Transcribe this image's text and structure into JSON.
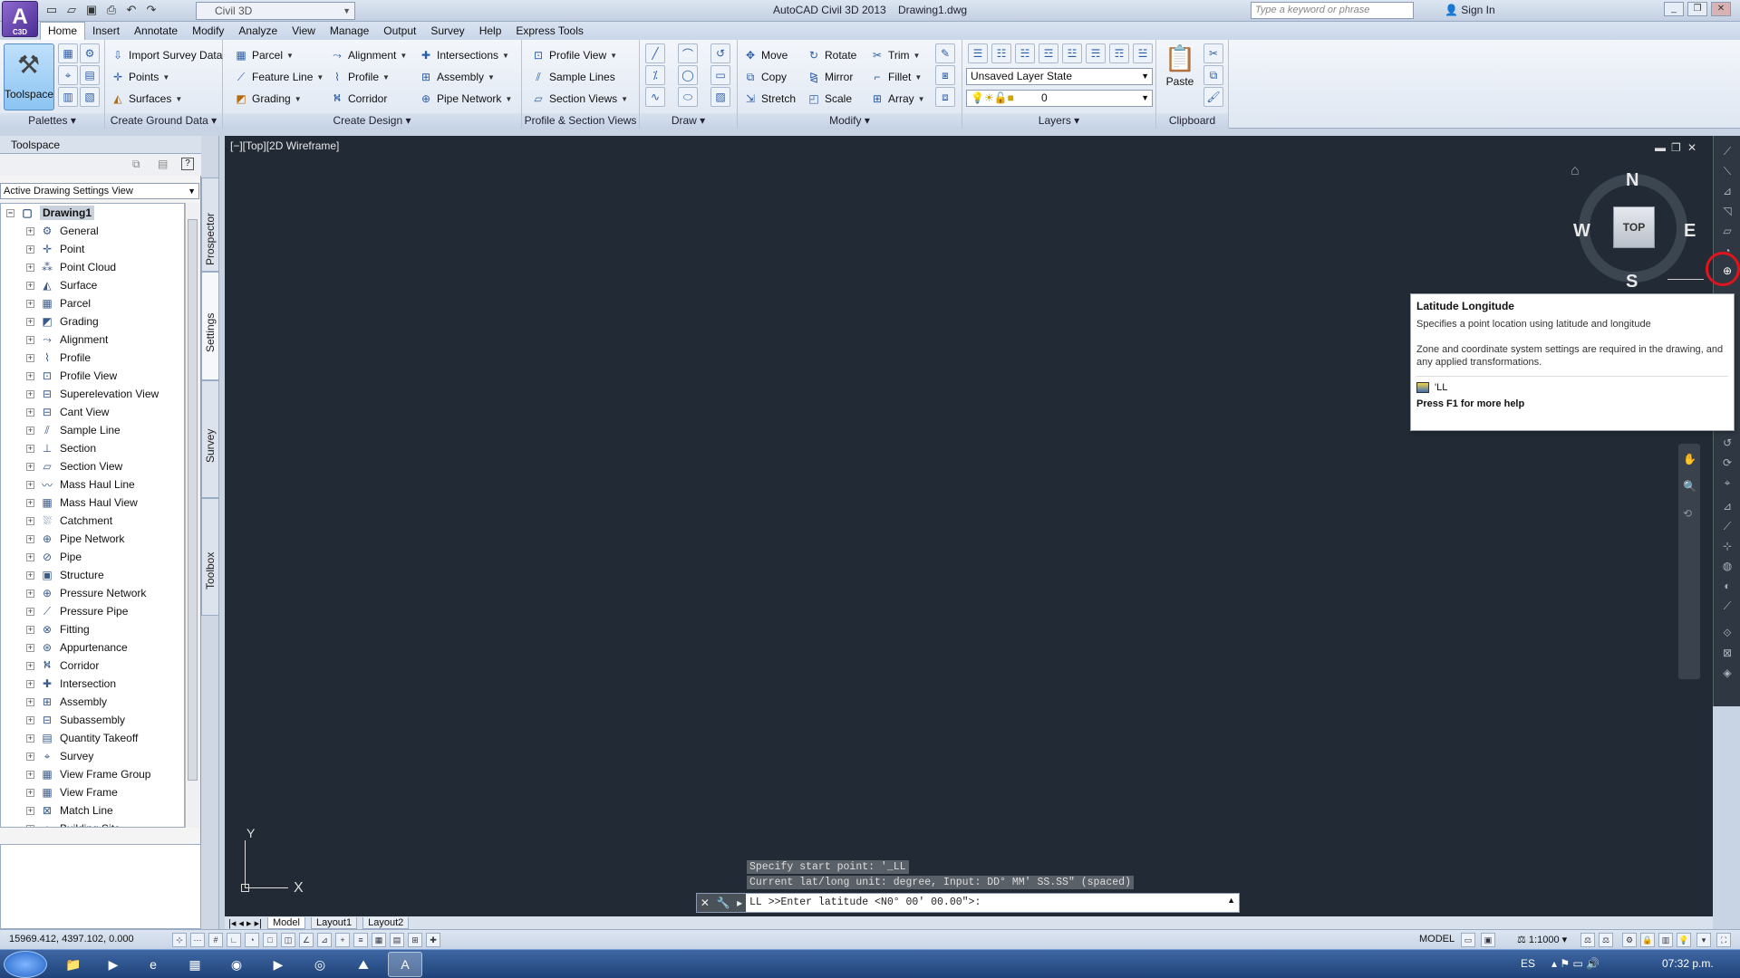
{
  "app": {
    "title": "AutoCAD Civil 3D 2013",
    "document": "Drawing1.dwg",
    "logo_text": "C3D",
    "workspace": "Civil 3D",
    "search_placeholder": "Type a keyword or phrase",
    "sign_in": "Sign In"
  },
  "menu_tabs": [
    "Home",
    "Insert",
    "Annotate",
    "Modify",
    "Analyze",
    "View",
    "Manage",
    "Output",
    "Survey",
    "Help",
    "Express Tools"
  ],
  "ribbon": {
    "palettes": {
      "big_label": "Toolspace",
      "title": "Palettes"
    },
    "ground": {
      "title": "Create Ground Data",
      "items": [
        "Import Survey Data",
        "Points",
        "Surfaces"
      ]
    },
    "design": {
      "title": "Create Design",
      "col1": [
        "Parcel",
        "Feature Line",
        "Grading"
      ],
      "col2": [
        "Alignment",
        "Profile",
        "Corridor"
      ],
      "col3": [
        "Intersections",
        "Assembly",
        "Pipe Network"
      ]
    },
    "profile": {
      "title": "Profile & Section Views",
      "items": [
        "Profile View",
        "Sample Lines",
        "Section Views"
      ]
    },
    "draw": {
      "title": "Draw"
    },
    "modify": {
      "title": "Modify",
      "col1": [
        "Move",
        "Copy",
        "Stretch"
      ],
      "col2": [
        "Rotate",
        "Mirror",
        "Scale"
      ],
      "col3": [
        "Trim",
        "Fillet",
        "Array"
      ]
    },
    "layers": {
      "title": "Layers",
      "layer_state": "Unsaved Layer State",
      "current_layer": "0"
    },
    "clipboard": {
      "title": "Clipboard",
      "paste": "Paste"
    }
  },
  "toolspace": {
    "title": "Toolspace",
    "view": "Active Drawing Settings View",
    "vertical_tabs": [
      "Prospector",
      "Settings",
      "Survey",
      "Toolbox"
    ],
    "root": "Drawing1",
    "items": [
      "General",
      "Point",
      "Point Cloud",
      "Surface",
      "Parcel",
      "Grading",
      "Alignment",
      "Profile",
      "Profile View",
      "Superelevation View",
      "Cant View",
      "Sample Line",
      "Section",
      "Section View",
      "Mass Haul Line",
      "Mass Haul View",
      "Catchment",
      "Pipe Network",
      "Pipe",
      "Structure",
      "Pressure Network",
      "Pressure Pipe",
      "Fitting",
      "Appurtenance",
      "Corridor",
      "Intersection",
      "Assembly",
      "Subassembly",
      "Quantity Takeoff",
      "Survey",
      "View Frame Group",
      "View Frame",
      "Match Line",
      "Building Site"
    ]
  },
  "viewport": {
    "label": "[−][Top][2D Wireframe]",
    "viewcube": "TOP",
    "compass": {
      "n": "N",
      "s": "S",
      "e": "E",
      "w": "W"
    },
    "ucs": {
      "x": "X",
      "y": "Y"
    }
  },
  "tooltip": {
    "title": "Latitude Longitude",
    "line1": "Specifies a point location using latitude and longitude",
    "line2": "Zone and coordinate system settings are required in the drawing, and any applied transformations.",
    "command": "'LL",
    "help": "Press F1 for more help"
  },
  "command": {
    "history1": "Specify start point: '_LL",
    "history2": "Current lat/long unit: degree, Input: DD° MM' SS.SS\" (spaced)",
    "prompt": "LL >>Enter latitude <N0° 00' 00.00\">:"
  },
  "layout_tabs": [
    "Model",
    "Layout1",
    "Layout2"
  ],
  "status": {
    "coords": "15969.412, 4397.102, 0.000",
    "model": "MODEL",
    "scale": "1:1000"
  },
  "taskbar": {
    "lang": "ES",
    "clock": "07:32 p.m."
  },
  "colors": {
    "canvas": "#222b35",
    "highlight": "#e0141c"
  }
}
